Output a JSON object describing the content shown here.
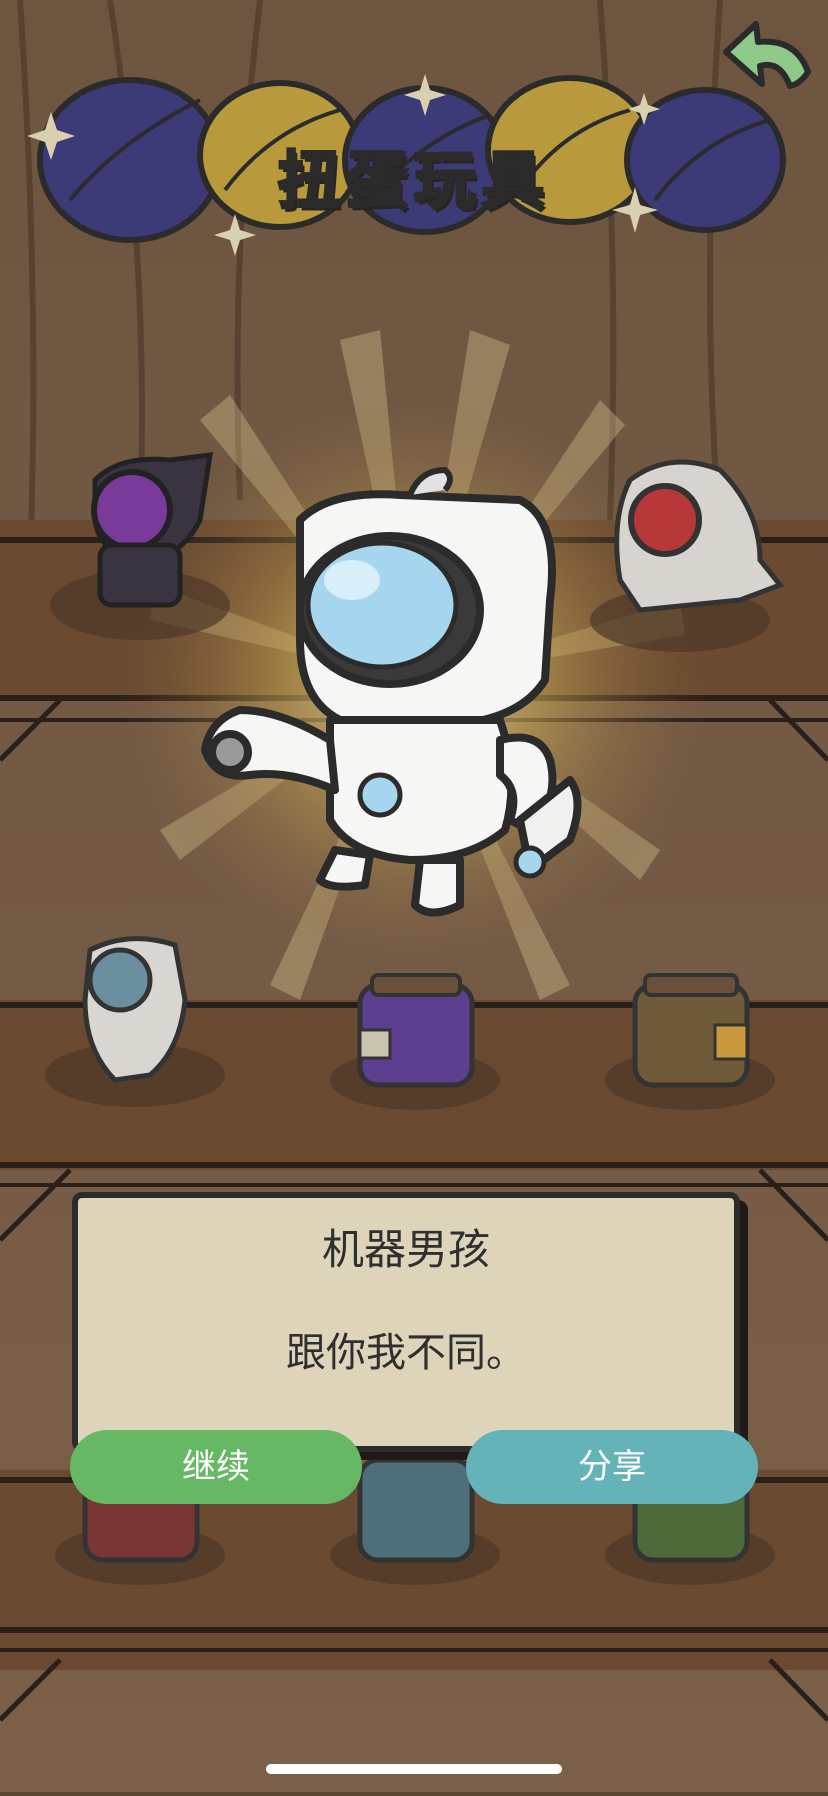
{
  "header": {
    "title": "扭蛋玩具",
    "back_icon": "back-arrow-icon"
  },
  "colors": {
    "continue_button": "#66b864",
    "share_button": "#63b3b8",
    "dialog_bg": "#ded4ba",
    "shelf_wood": "#6a4a31"
  },
  "dialog": {
    "name": "机器男孩",
    "description": "跟你我不同。"
  },
  "buttons": {
    "continue_label": "继续",
    "share_label": "分享"
  }
}
